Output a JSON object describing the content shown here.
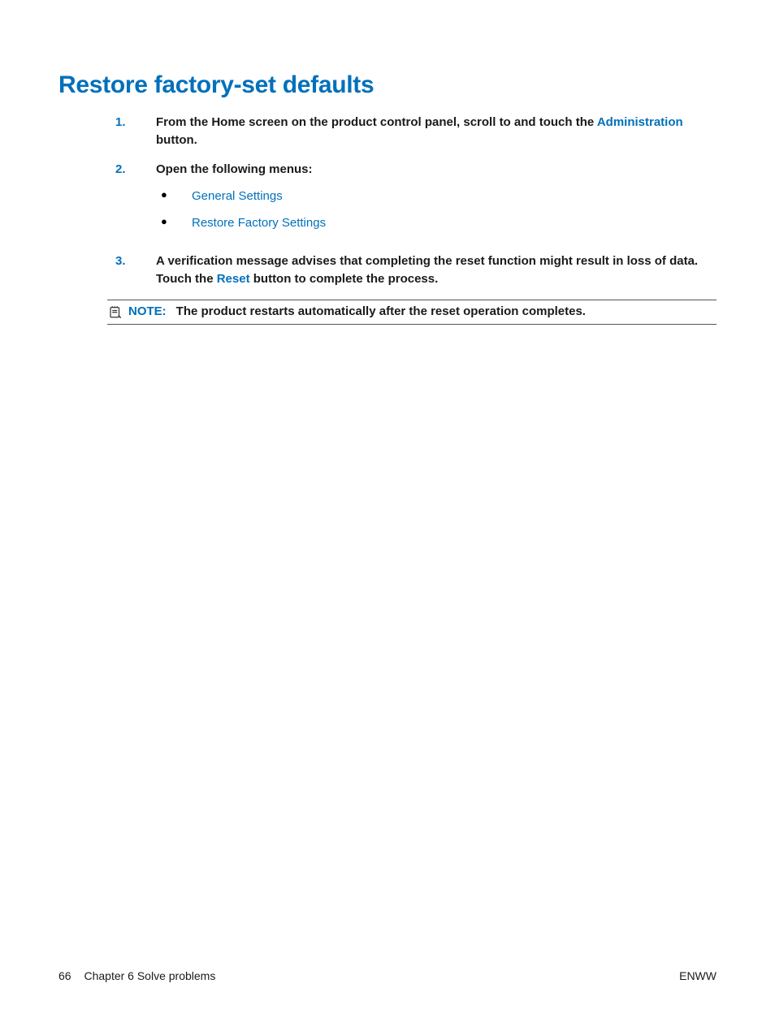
{
  "heading": "Restore factory-set defaults",
  "steps": [
    {
      "num": "1.",
      "parts": [
        {
          "text": "From the Home screen on the product control panel, scroll to and touch the "
        },
        {
          "text": "Administration",
          "ui": true
        },
        {
          "text": " button."
        }
      ]
    },
    {
      "num": "2.",
      "parts": [
        {
          "text": "Open the following menus:"
        }
      ],
      "bullets": [
        "General Settings",
        "Restore Factory Settings"
      ]
    },
    {
      "num": "3.",
      "parts": [
        {
          "text": "A verification message advises that completing the reset function might result in loss of data. Touch the "
        },
        {
          "text": "Reset",
          "ui": true
        },
        {
          "text": " button to complete the process."
        }
      ]
    }
  ],
  "note": {
    "label": "NOTE:",
    "text": "The product restarts automatically after the reset operation completes."
  },
  "footer": {
    "page_number": "66",
    "chapter": "Chapter 6   Solve problems",
    "right": "ENWW"
  },
  "bullet_glyph": "●"
}
